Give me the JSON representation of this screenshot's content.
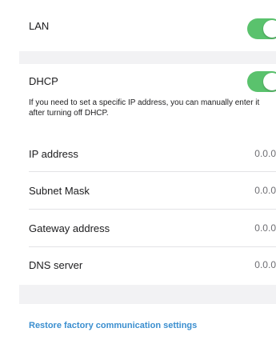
{
  "lan": {
    "label": "LAN",
    "enabled": true
  },
  "dhcp": {
    "label": "DHCP",
    "enabled": true,
    "help": "If you need to set a specific IP address, you can manually enter it after turning off DHCP."
  },
  "network_fields": [
    {
      "label": "IP address",
      "value": "0.0.0"
    },
    {
      "label": "Subnet Mask",
      "value": "0.0.0"
    },
    {
      "label": "Gateway address",
      "value": "0.0.0"
    },
    {
      "label": "DNS server",
      "value": "0.0.0"
    }
  ],
  "restore": {
    "label": "Restore factory communication settings"
  },
  "colors": {
    "toggle_on": "#5ac26d",
    "link": "#3a8ecf",
    "background": "#f2f2f4"
  }
}
